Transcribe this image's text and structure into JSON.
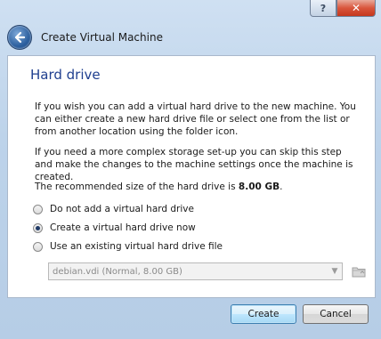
{
  "window": {
    "help_glyph": "?",
    "close_glyph": "✕",
    "title": "Create Virtual Machine"
  },
  "page": {
    "heading": "Hard drive",
    "paragraph1": "If you wish you can add a virtual hard drive to the new machine. You can either create a new hard drive file or select one from the list or from another location using the folder icon.",
    "paragraph2": "If you need a more complex storage set-up you can skip this step and make the changes to the machine settings once the machine is created.",
    "recommended_prefix": "The recommended size of the hard drive is ",
    "recommended_size": "8.00 GB",
    "recommended_suffix": "."
  },
  "options": [
    {
      "label": "Do not add a virtual hard drive",
      "checked": false
    },
    {
      "label": "Create a virtual hard drive now",
      "checked": true
    },
    {
      "label": "Use an existing virtual hard drive file",
      "checked": false
    }
  ],
  "existing_file": {
    "selected": "debian.vdi (Normal, 8.00 GB)"
  },
  "buttons": {
    "create": "Create",
    "cancel": "Cancel"
  },
  "colors": {
    "heading": "#1f3f8f",
    "accent": "#3c7fb1"
  },
  "icons": {
    "back": "back-arrow-icon",
    "folder": "folder-icon",
    "dropdown": "chevron-down-icon"
  }
}
